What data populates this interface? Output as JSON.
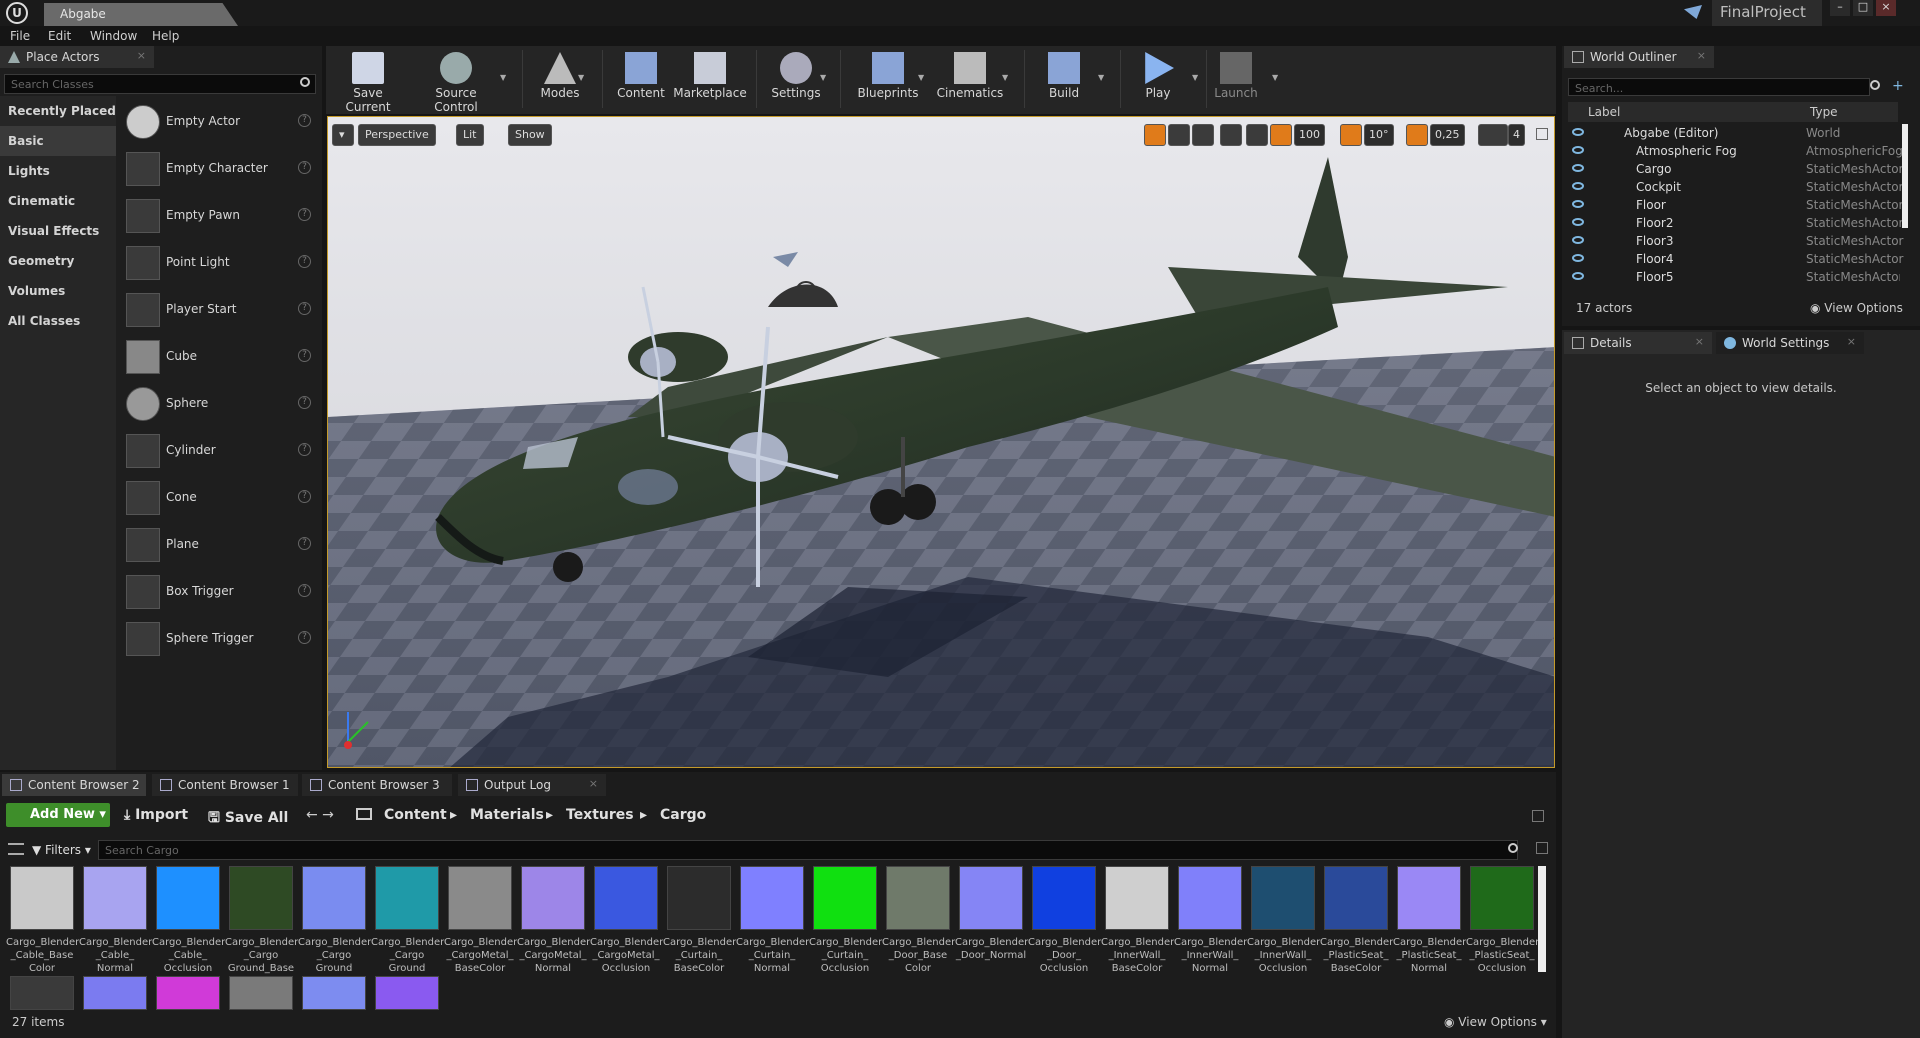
{
  "title_bar": {
    "tab_title": "Abgabe",
    "project_name": "FinalProject"
  },
  "menu": [
    "File",
    "Edit",
    "Window",
    "Help"
  ],
  "place_actors": {
    "tab_label": "Place Actors",
    "search_placeholder": "Search Classes",
    "categories": [
      "Recently Placed",
      "Basic",
      "Lights",
      "Cinematic",
      "Visual Effects",
      "Geometry",
      "Volumes",
      "All Classes"
    ],
    "selected_category": "Basic",
    "items": [
      "Empty Actor",
      "Empty Character",
      "Empty Pawn",
      "Point Light",
      "Player Start",
      "Cube",
      "Sphere",
      "Cylinder",
      "Cone",
      "Plane",
      "Box Trigger",
      "Sphere Trigger"
    ]
  },
  "toolbar": {
    "buttons": [
      "Save Current",
      "Source Control",
      "Modes",
      "Content",
      "Marketplace",
      "Settings",
      "Blueprints",
      "Cinematics",
      "Build",
      "Play",
      "Launch"
    ]
  },
  "viewport": {
    "view_mode": "Perspective",
    "lighting": "Lit",
    "show_label": "Show",
    "grid_snap": "100",
    "rotation_snap": "10°",
    "scale_snap": "0,25",
    "camera_speed": "4"
  },
  "world_outliner": {
    "tab_label": "World Outliner",
    "search_placeholder": "Search...",
    "col_label": "Label",
    "col_type": "Type",
    "rows": [
      {
        "label": "Abgabe (Editor)",
        "type": "World"
      },
      {
        "label": "Atmospheric Fog",
        "type": "AtmosphericFog"
      },
      {
        "label": "Cargo",
        "type": "StaticMeshActor"
      },
      {
        "label": "Cockpit",
        "type": "StaticMeshActor"
      },
      {
        "label": "Floor",
        "type": "StaticMeshActor"
      },
      {
        "label": "Floor2",
        "type": "StaticMeshActor"
      },
      {
        "label": "Floor3",
        "type": "StaticMeshActor"
      },
      {
        "label": "Floor4",
        "type": "StaticMeshActor"
      },
      {
        "label": "Floor5",
        "type": "StaticMeshActor"
      }
    ],
    "actor_count": "17 actors",
    "view_options": "View Options"
  },
  "details": {
    "tab_details": "Details",
    "tab_world_settings": "World Settings",
    "empty_message": "Select an object to view details."
  },
  "bottom_tabs": [
    "Content Browser 2",
    "Content Browser 1",
    "Content Browser 3",
    "Output Log"
  ],
  "content_browser": {
    "add_new": "Add New",
    "import": "Import",
    "save_all": "Save All",
    "breadcrumb": [
      "Content",
      "Materials",
      "Textures",
      "Cargo"
    ],
    "filters": "Filters",
    "search_placeholder": "Search Cargo",
    "item_count": "27 items",
    "view_options": "View Options",
    "assets": [
      {
        "name": "Cargo_Blender\n_Cable_Base\nColor",
        "color": "#c9c9c9"
      },
      {
        "name": "Cargo_Blender\n_Cable_\nNormal",
        "color": "#a8a4f0"
      },
      {
        "name": "Cargo_Blender\n_Cable_\nOcclusion",
        "color": "#1e90ff"
      },
      {
        "name": "Cargo_Blender\n_Cargo\nGround_Base",
        "color": "#2e4a24"
      },
      {
        "name": "Cargo_Blender\n_Cargo\nGround",
        "color": "#7a8cf0"
      },
      {
        "name": "Cargo_Blender\n_Cargo\nGround",
        "color": "#1f9aa8"
      },
      {
        "name": "Cargo_Blender\n_CargoMetal_\nBaseColor",
        "color": "#8a8a8a"
      },
      {
        "name": "Cargo_Blender\n_CargoMetal_\nNormal",
        "color": "#9d86e8"
      },
      {
        "name": "Cargo_Blender\n_CargoMetal_\nOcclusion",
        "color": "#3a58e0"
      },
      {
        "name": "Cargo_Blender\n_Curtain_\nBaseColor",
        "color": "#2c2c2c"
      },
      {
        "name": "Cargo_Blender\n_Curtain_\nNormal",
        "color": "#7f80ff"
      },
      {
        "name": "Cargo_Blender\n_Curtain_\nOcclusion",
        "color": "#10e010"
      },
      {
        "name": "Cargo_Blender\n_Door_Base\nColor",
        "color": "#6f7a6a"
      },
      {
        "name": "Cargo_Blender\n_Door_Normal",
        "color": "#8585f5"
      },
      {
        "name": "Cargo_Blender\n_Door_\nOcclusion",
        "color": "#1040e0"
      },
      {
        "name": "Cargo_Blender\n_InnerWall_\nBaseColor",
        "color": "#cfcfcf"
      },
      {
        "name": "Cargo_Blender\n_InnerWall_\nNormal",
        "color": "#8080fa"
      },
      {
        "name": "Cargo_Blender\n_InnerWall_\nOcclusion",
        "color": "#1e4e70"
      },
      {
        "name": "Cargo_Blender\n_PlasticSeat_\nBaseColor",
        "color": "#2a4a9a"
      },
      {
        "name": "Cargo_Blender\n_PlasticSeat_\nNormal",
        "color": "#9a88f5"
      },
      {
        "name": "Cargo_Blender\n_PlasticSeat_\nOcclusion",
        "color": "#1f6a1a"
      }
    ],
    "second_row_colors": [
      "#3a3a3a",
      "#7b7bf0",
      "#d03ad8",
      "#7a7a7a",
      "#7d8cf0",
      "#8a5af0"
    ]
  }
}
